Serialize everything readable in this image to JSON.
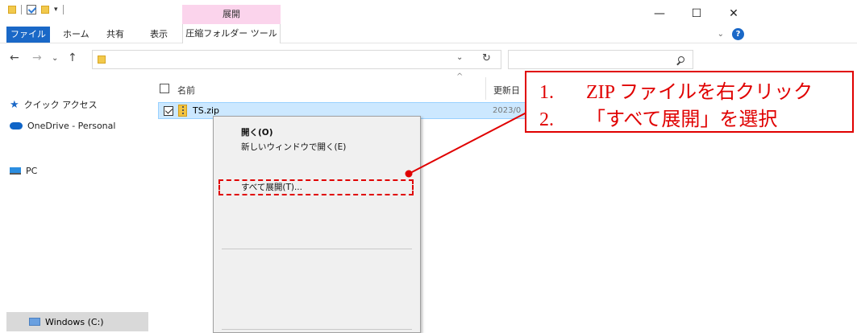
{
  "titlebar": {
    "context_tab_header": "展開",
    "minimize": "—",
    "maximize": "☐",
    "close": "✕"
  },
  "ribbon": {
    "tabs": [
      "ファイル",
      "ホーム",
      "共有",
      "表示",
      "圧縮フォルダー ツール"
    ],
    "help": "?"
  },
  "nav": {
    "back": "←",
    "forward": "→",
    "recent": "⌄",
    "up": "↑",
    "addr_dropdown": "⌄",
    "refresh": "↻"
  },
  "navpane": {
    "quick_access": "クイック アクセス",
    "onedrive": "OneDrive - Personal",
    "pc": "PC",
    "drive": "Windows (C:)"
  },
  "columns": {
    "name": "名前",
    "modified": "更新日"
  },
  "file": {
    "name": "TS.zip",
    "date": "2023/0"
  },
  "context_menu": {
    "open": "開く(O)",
    "open_new_window": "新しいウィンドウで開く(E)",
    "extract_all": "すべて展開(T)..."
  },
  "callout": {
    "step1_num": "1.",
    "step1_text": "ZIP ファイルを右クリック",
    "step2_num": "2.",
    "step2_text": "「すべて展開」を選択"
  },
  "colors": {
    "accent_blue": "#1a68c7",
    "selection": "#cce8ff",
    "annotation_red": "#e00000",
    "context_tab_pink": "#fbd4ec"
  }
}
